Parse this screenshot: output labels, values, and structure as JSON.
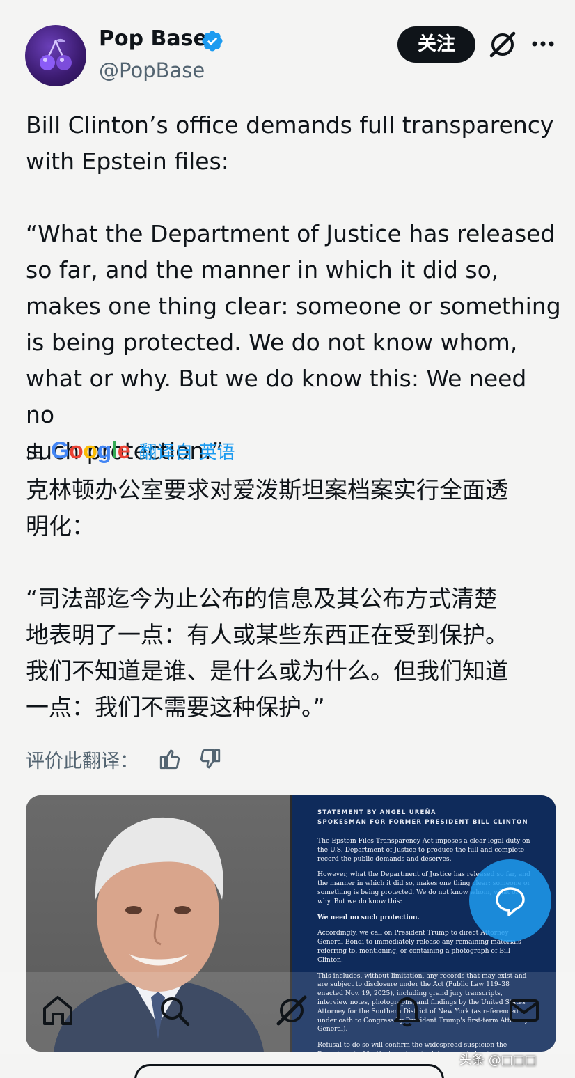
{
  "header": {
    "display_name": "Pop Base",
    "handle": "@PopBase",
    "follow_label": "关注",
    "avatar_icon": "cherry-icon",
    "verified_color": "#1d9bf0"
  },
  "tweet": {
    "text": "Bill Clinton’s office demands full transparency\nwith Epstein files:\n\n“What the Department of Justice has released\nso far, and the manner in which it did so,\nmakes one thing clear: someone or something\nis being protected. We do not know whom,\nwhat or why. But we do know this: We need no\nsuch protection.”"
  },
  "translation": {
    "by_label": "由",
    "google": [
      "G",
      "o",
      "o",
      "g",
      "l",
      "e"
    ],
    "link_label": "翻译自 英语",
    "text": "克林顿办公室要求对爱泼斯坦案档案实行全面透\n明化：\n\n“司法部迄今为止公布的信息及其公布方式清楚\n地表明了一点：有人或某些东西正在受到保护。\n我们不知道是谁、是什么或为什么。但我们知道\n一点：我们不需要这种保护。”",
    "rate_label": "评价此翻译："
  },
  "statement": {
    "heading_1": "STATEMENT BY ANGEL UREÑA",
    "heading_2": "SPOKESMAN FOR FORMER PRESIDENT BILL CLINTON",
    "p1": "The Epstein Files Transparency Act imposes a clear legal duty on the U.S. Department of Justice to produce the full and complete record the public demands and deserves.",
    "p2": "However, what the Department of Justice has released so far, and the manner in which it did so, makes one thing clear: someone or something is being protected. We do not know whom, what or why. But we do know this:",
    "p3": "We need no such protection.",
    "p4": "Accordingly, we call on President Trump to direct Attorney General Bondi to immediately release any remaining materials referring to, mentioning, or containing a photograph of Bill Clinton.",
    "p5": "This includes, without limitation, any records that may exist and are subject to disclosure under the Act (Public Law 119–38 enacted Nov. 19, 2025), including grand jury transcripts, interview notes, photographs, and findings by the United States Attorney for the Southern District of New York (as referenced under oath to Congress by President Trump's first-term Attorney General).",
    "p6": "Refusal to do so will confirm the widespread suspicion the Department of Justice's actions to date are not about transparency, but about insinuation – using selective releases to imply wrongdoing about"
  },
  "nav": {
    "icons": [
      "home-icon",
      "search-icon",
      "grok-icon",
      "notifications-icon",
      "messages-icon"
    ]
  },
  "watermark": "头条 @□□□"
}
